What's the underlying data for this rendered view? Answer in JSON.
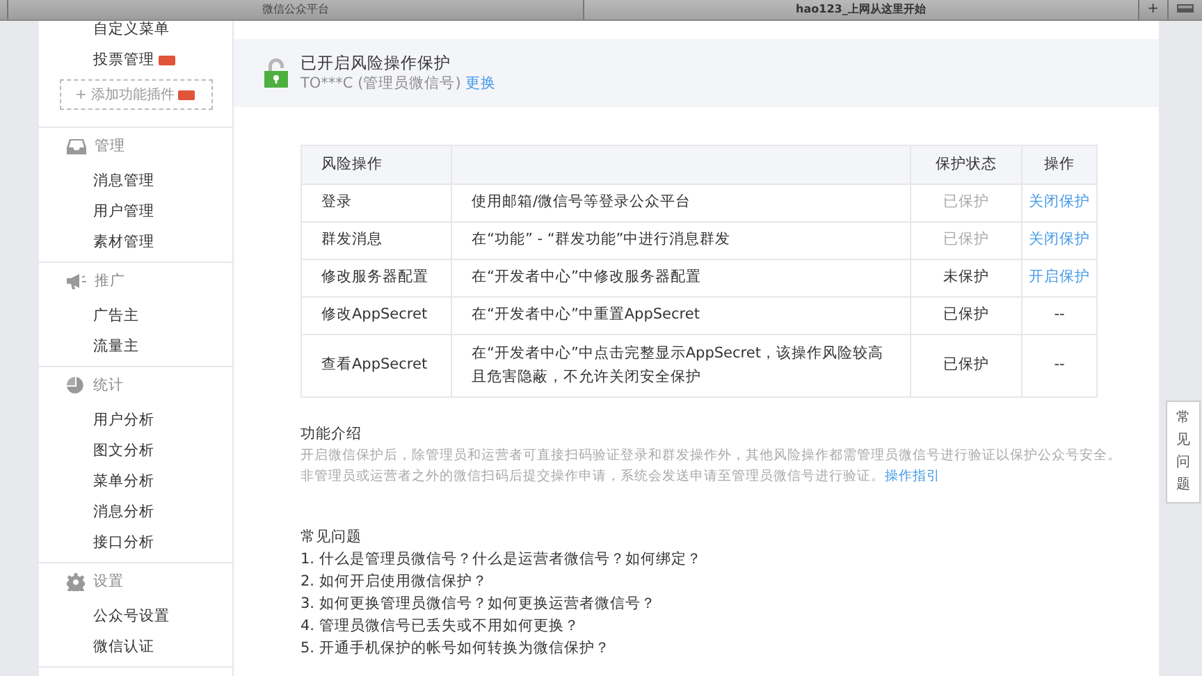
{
  "browser": {
    "tabs": [
      {
        "title": "微信公众平台",
        "selected": false
      },
      {
        "title": "hao123_上网从这里开始",
        "selected": true
      }
    ],
    "new_tab_button": "+"
  },
  "sidebar": {
    "top_items": [
      {
        "label": "自定义菜单",
        "new": false
      },
      {
        "label": "投票管理",
        "new": true
      }
    ],
    "add_plugin": {
      "icon": "+",
      "label": "添加功能插件",
      "new": true
    },
    "sections": [
      {
        "title": "管理",
        "items": [
          "消息管理",
          "用户管理",
          "素材管理"
        ]
      },
      {
        "title": "推广",
        "items": [
          "广告主",
          "流量主"
        ]
      },
      {
        "title": "统计",
        "items": [
          "用户分析",
          "图文分析",
          "菜单分析",
          "消息分析",
          "接口分析"
        ]
      },
      {
        "title": "设置",
        "items": [
          "公众号设置",
          "微信认证"
        ]
      }
    ]
  },
  "protection": {
    "title": "已开启风险操作保护",
    "account": "TO***C (管理员微信号)",
    "link": "更换"
  },
  "table": {
    "column_1": "风险操作",
    "column_3": "保护状态",
    "column_4": "操作",
    "rows": [
      {
        "operation": "登录",
        "description": "使用邮箱/微信号等登录公众平台",
        "status": "已保护",
        "status_dimmed": true,
        "action": {
          "kind": "link",
          "text": "关闭保护"
        }
      },
      {
        "operation": "群发消息",
        "description": "在“功能” - “群发功能”中进行消息群发",
        "status": "已保护",
        "status_dimmed": true,
        "action": {
          "kind": "link",
          "text": "关闭保护"
        }
      },
      {
        "operation": "修改服务器配置",
        "description": "在“开发者中心”中修改服务器配置",
        "status": "未保护",
        "status_dimmed": false,
        "action": {
          "kind": "link",
          "text": "开启保护"
        }
      },
      {
        "operation": "修改AppSecret",
        "description": "在“开发者中心”中重置AppSecret",
        "status": "已保护",
        "status_dimmed": false,
        "action": {
          "kind": "text",
          "text": "--"
        }
      },
      {
        "operation": "查看AppSecret",
        "description": "在“开发者中心”中点击完整显示AppSecret，该操作风险较高且危害隐蔽，不允许关闭安全保护",
        "status": "已保护",
        "status_dimmed": false,
        "action": {
          "kind": "text",
          "text": "--"
        }
      }
    ]
  },
  "intro": {
    "title": "功能介绍",
    "lines": [
      "开启微信保护后，除管理员和运营者可直接扫码验证登录和群发操作外，其他风险操作都需管理员微信号进行验证以保护公众号安全。",
      "非管理员或运营者之外的微信扫码后提交操作申请，系统会发送申请至管理员微信号进行验证。"
    ],
    "link": "操作指引"
  },
  "faq": {
    "title": "常见问题",
    "items": [
      "1. 什么是管理员微信号？什么是运营者微信号？如何绑定？",
      "2. 如何开启使用微信保护？",
      "3. 如何更换管理员微信号？如何更换运营者微信号？",
      "4. 管理员微信号已丢失或不用如何更换？",
      "5. 开通手机保护的帐号如何转换为微信保护？"
    ]
  },
  "help_button": "常见问题"
}
